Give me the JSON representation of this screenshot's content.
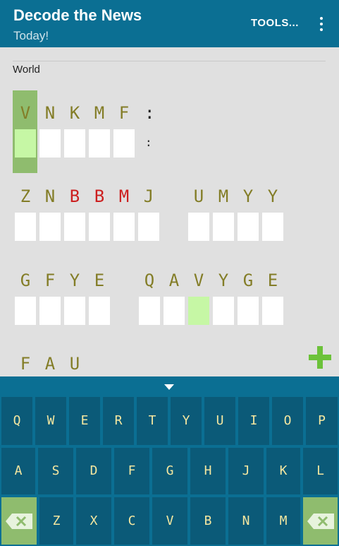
{
  "appbar": {
    "title": "Decode the News",
    "subtitle": "Today!",
    "tools_label": "TOOLS..."
  },
  "category": "World",
  "puzzle": {
    "row1": {
      "letters": [
        "V",
        "N",
        "K",
        "M",
        "F"
      ],
      "punct": ":"
    },
    "row2": {
      "word1": [
        "Z",
        "N",
        "B",
        "B",
        "M",
        "J"
      ],
      "word2": [
        "U",
        "M",
        "Y",
        "Y"
      ]
    },
    "row3": {
      "word1": [
        "G",
        "F",
        "Y",
        "E"
      ],
      "word2": [
        "Q",
        "A",
        "V",
        "Y",
        "G",
        "E"
      ]
    },
    "row4": {
      "letters": [
        "F",
        "A",
        "U"
      ]
    }
  },
  "colors": {
    "cipher_letter": "#837d27",
    "flagged_letter": "#cc1f1f",
    "highlight": "#c6f7a5",
    "selected": "#8fbc6e",
    "appbar": "#0b6f93",
    "key": "#0b5a78"
  },
  "keyboard": {
    "row1": [
      "Q",
      "W",
      "E",
      "R",
      "T",
      "Y",
      "U",
      "I",
      "O",
      "P"
    ],
    "row2": [
      "A",
      "S",
      "D",
      "F",
      "G",
      "H",
      "J",
      "K",
      "L"
    ],
    "row3": [
      "Z",
      "X",
      "C",
      "V",
      "B",
      "N",
      "M"
    ]
  }
}
